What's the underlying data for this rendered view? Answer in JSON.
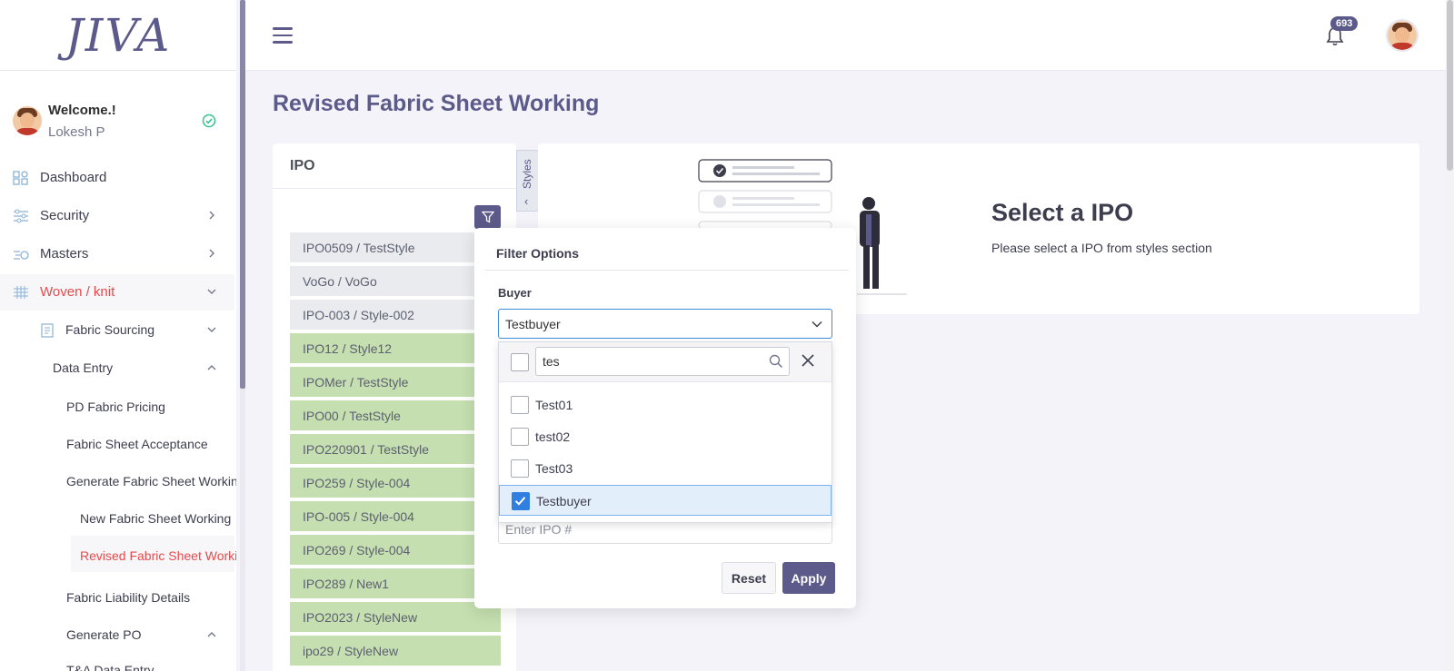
{
  "brand": {
    "logo_text": "JIVA"
  },
  "user": {
    "welcome": "Welcome.!",
    "name": "Lokesh P"
  },
  "sidebar": {
    "items": [
      {
        "label": "Dashboard",
        "icon": "dashboard-icon"
      },
      {
        "label": "Security",
        "icon": "sliders-icon"
      },
      {
        "label": "Masters",
        "icon": "masters-icon"
      },
      {
        "label": "Woven / knit",
        "icon": "grid-icon"
      }
    ],
    "fabric_sourcing": "Fabric Sourcing",
    "data_entry": "Data Entry",
    "pd_fabric_pricing": "PD Fabric Pricing",
    "fabric_sheet_acceptance": "Fabric Sheet Acceptance",
    "generate_fabric_sheet_working": "Generate Fabric Sheet Working",
    "new_fabric_sheet_working": "New Fabric Sheet Working",
    "revised_fabric_sheet_working": "Revised Fabric Sheet Working",
    "fabric_liability_details": "Fabric Liability Details",
    "generate_po": "Generate PO",
    "ta_data_entry": "T&A Data Entry"
  },
  "topbar": {
    "notification_count": "693"
  },
  "page": {
    "title": "Revised Fabric Sheet Working"
  },
  "ipo_panel": {
    "title": "IPO",
    "styles_tab": "Styles",
    "items": [
      {
        "label": "IPO0509 / TestStyle",
        "status": "grey"
      },
      {
        "label": "VoGo / VoGo",
        "status": "grey"
      },
      {
        "label": "IPO-003 / Style-002",
        "status": "grey"
      },
      {
        "label": "IPO12 / Style12",
        "status": "green"
      },
      {
        "label": "IPOMer / TestStyle",
        "status": "green"
      },
      {
        "label": "IPO00 / TestStyle",
        "status": "green"
      },
      {
        "label": "IPO220901 / TestStyle",
        "status": "green"
      },
      {
        "label": "IPO259 / Style-004",
        "status": "green"
      },
      {
        "label": "IPO-005 / Style-004",
        "status": "green"
      },
      {
        "label": "IPO269 / Style-004",
        "status": "green"
      },
      {
        "label": "IPO289 / New1",
        "status": "green"
      },
      {
        "label": "IPO2023 / StyleNew",
        "status": "green"
      },
      {
        "label": "ipo29 / StyleNew",
        "status": "green"
      }
    ]
  },
  "empty_state": {
    "title": "Select a IPO",
    "subtitle": "Please select a IPO from styles section"
  },
  "filter": {
    "title": "Filter Options",
    "buyer_label": "Buyer",
    "buyer_value": "Testbuyer",
    "search_value": "tes",
    "options": [
      {
        "label": "Test01",
        "checked": false
      },
      {
        "label": "test02",
        "checked": false
      },
      {
        "label": "Test03",
        "checked": false
      },
      {
        "label": "Testbuyer",
        "checked": true
      }
    ],
    "ipo_placeholder": "Enter IPO #",
    "reset_label": "Reset",
    "apply_label": "Apply"
  },
  "colors": {
    "brand": "#5b5a8a",
    "active_nav": "#e84a4a",
    "ipo_green": "#c5dfb0",
    "checkbox_blue": "#2f7ee0"
  }
}
